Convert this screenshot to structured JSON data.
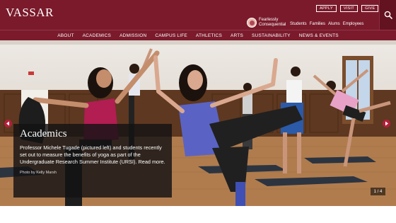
{
  "brand": {
    "logo": "VASSAR",
    "tagline": "Fearlessly Consequential",
    "accent": "#7a1a2b"
  },
  "audience_links": [
    "Students",
    "Families",
    "Alums",
    "Employees"
  ],
  "utility_buttons": [
    "APPLY",
    "VISIT",
    "GIVE"
  ],
  "search_icon": "search-icon",
  "nav": [
    "ABOUT",
    "ACADEMICS",
    "ADMISSION",
    "CAMPUS LIFE",
    "ATHLETICS",
    "ARTS",
    "SUSTAINABILITY",
    "NEWS & EVENTS"
  ],
  "hero": {
    "title": "Academics",
    "body": "Professor Michele Tugade (pictured left) and students recently set out to measure the benefits of yoga as part of the Undergraduate Research Summer Institute (URSI). Read more.",
    "credit": "Photo by Kelly Marsh",
    "counter": "1 / 4",
    "prev_icon": "chevron-left-icon",
    "next_icon": "chevron-right-icon"
  }
}
